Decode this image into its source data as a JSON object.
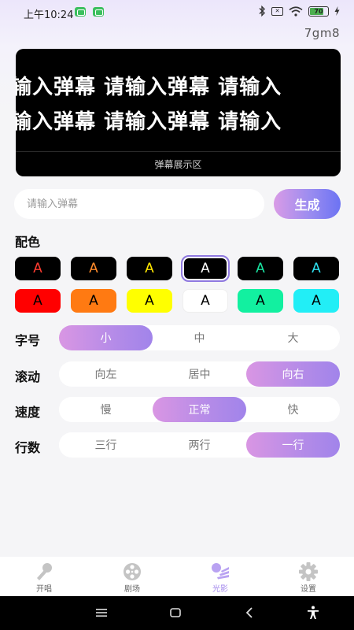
{
  "status_bar": {
    "time": "上午10:24",
    "battery_level": "70"
  },
  "app_code": "7gm8",
  "danmaku": {
    "text_line1": "输入弹幕 请输入弹幕 请输入",
    "text_line2": "输入弹幕 请输入弹幕 请输入",
    "caption": "弹幕展示区"
  },
  "input": {
    "placeholder": "请输入弹幕",
    "value": ""
  },
  "generate_label": "生成",
  "color_section": {
    "title": "配色",
    "swatch_letter": "A",
    "row1": [
      {
        "bg": "#000000",
        "fg": "#ff3b30"
      },
      {
        "bg": "#000000",
        "fg": "#ff8a2a"
      },
      {
        "bg": "#000000",
        "fg": "#ffe600"
      },
      {
        "bg": "#000000",
        "fg": "#ffffff",
        "selected": true
      },
      {
        "bg": "#000000",
        "fg": "#19e3a0"
      },
      {
        "bg": "#000000",
        "fg": "#2ee0f0"
      }
    ],
    "row2": [
      {
        "bg": "#ff0000",
        "fg": "#000000"
      },
      {
        "bg": "#ff7a12",
        "fg": "#000000"
      },
      {
        "bg": "#ffff00",
        "fg": "#000000"
      },
      {
        "bg": "#ffffff",
        "fg": "#000000"
      },
      {
        "bg": "#12f0a0",
        "fg": "#000000"
      },
      {
        "bg": "#22eef6",
        "fg": "#000000"
      }
    ]
  },
  "font_size": {
    "title": "字号",
    "options": [
      "小",
      "中",
      "大"
    ],
    "selected": 0
  },
  "scroll": {
    "title": "滚动",
    "options": [
      "向左",
      "居中",
      "向右"
    ],
    "selected": 2
  },
  "speed": {
    "title": "速度",
    "options": [
      "慢",
      "正常",
      "快"
    ],
    "selected": 1
  },
  "lines": {
    "title": "行数",
    "options": [
      "三行",
      "两行",
      "一行"
    ],
    "selected": 2
  },
  "tabs": [
    {
      "label": "开唱",
      "icon": "microphone-icon",
      "active": false
    },
    {
      "label": "剧场",
      "icon": "film-reel-icon",
      "active": false
    },
    {
      "label": "光影",
      "icon": "light-beams-icon",
      "active": true
    },
    {
      "label": "设置",
      "icon": "gear-icon",
      "active": false
    }
  ],
  "colors": {
    "accent_start": "#d996e3",
    "accent_end": "#6c73f3",
    "active_tab": "#a48aed"
  }
}
